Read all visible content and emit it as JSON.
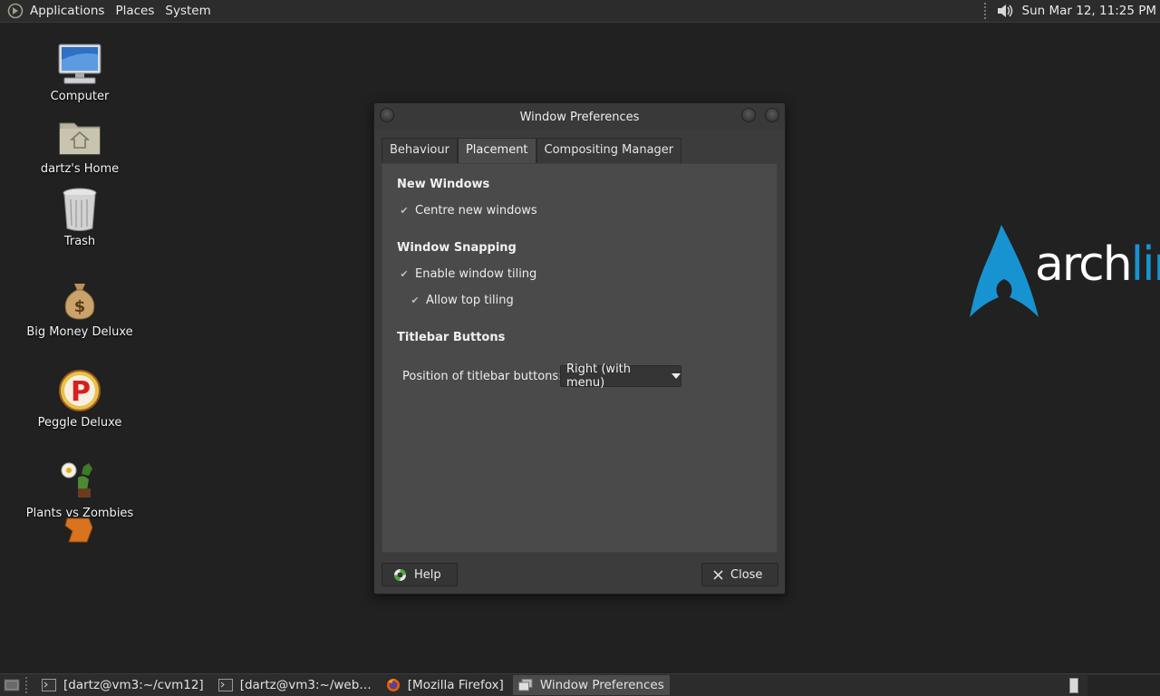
{
  "top_panel": {
    "menus": [
      "Applications",
      "Places",
      "System"
    ],
    "clock": "Sun Mar 12, 11:25 PM"
  },
  "desktop_icons": [
    {
      "label": "Computer",
      "icon": "computer-icon"
    },
    {
      "label": "dartz's Home",
      "icon": "home-folder-icon"
    },
    {
      "label": "Trash",
      "icon": "trash-icon"
    },
    {
      "label": "Big Money Deluxe",
      "icon": "money-bag-icon"
    },
    {
      "label": "Peggle Deluxe",
      "icon": "peggle-icon"
    },
    {
      "label": "Plants vs Zombies",
      "icon": "plants-zombies-icon"
    }
  ],
  "wallpaper_logo": {
    "text_white": "arch",
    "text_blue": "lin",
    "accent": "#1793d1"
  },
  "dialog": {
    "title": "Window Preferences",
    "tabs": [
      "Behaviour",
      "Placement",
      "Compositing Manager"
    ],
    "active_tab": "Placement",
    "sections": {
      "new_windows": {
        "title": "New Windows",
        "options": [
          {
            "label": "Centre new windows",
            "checked": true
          }
        ]
      },
      "window_snapping": {
        "title": "Window Snapping",
        "options": [
          {
            "label": "Enable window tiling",
            "checked": true
          },
          {
            "label": "Allow top tiling",
            "checked": true
          }
        ]
      },
      "titlebar_buttons": {
        "title": "Titlebar Buttons",
        "position_label": "Position of titlebar buttons:",
        "position_value": "Right (with menu)"
      }
    },
    "help_label": "Help",
    "close_label": "Close"
  },
  "taskbar": {
    "tasks": [
      {
        "label": "[dartz@vm3:~/cvm12]",
        "icon": "terminal-icon",
        "active": false
      },
      {
        "label": "[dartz@vm3:~/web…",
        "icon": "terminal-icon",
        "active": false
      },
      {
        "label": "[Mozilla Firefox]",
        "icon": "firefox-icon",
        "active": false
      },
      {
        "label": "Window Preferences",
        "icon": "window-icon",
        "active": true
      }
    ]
  }
}
